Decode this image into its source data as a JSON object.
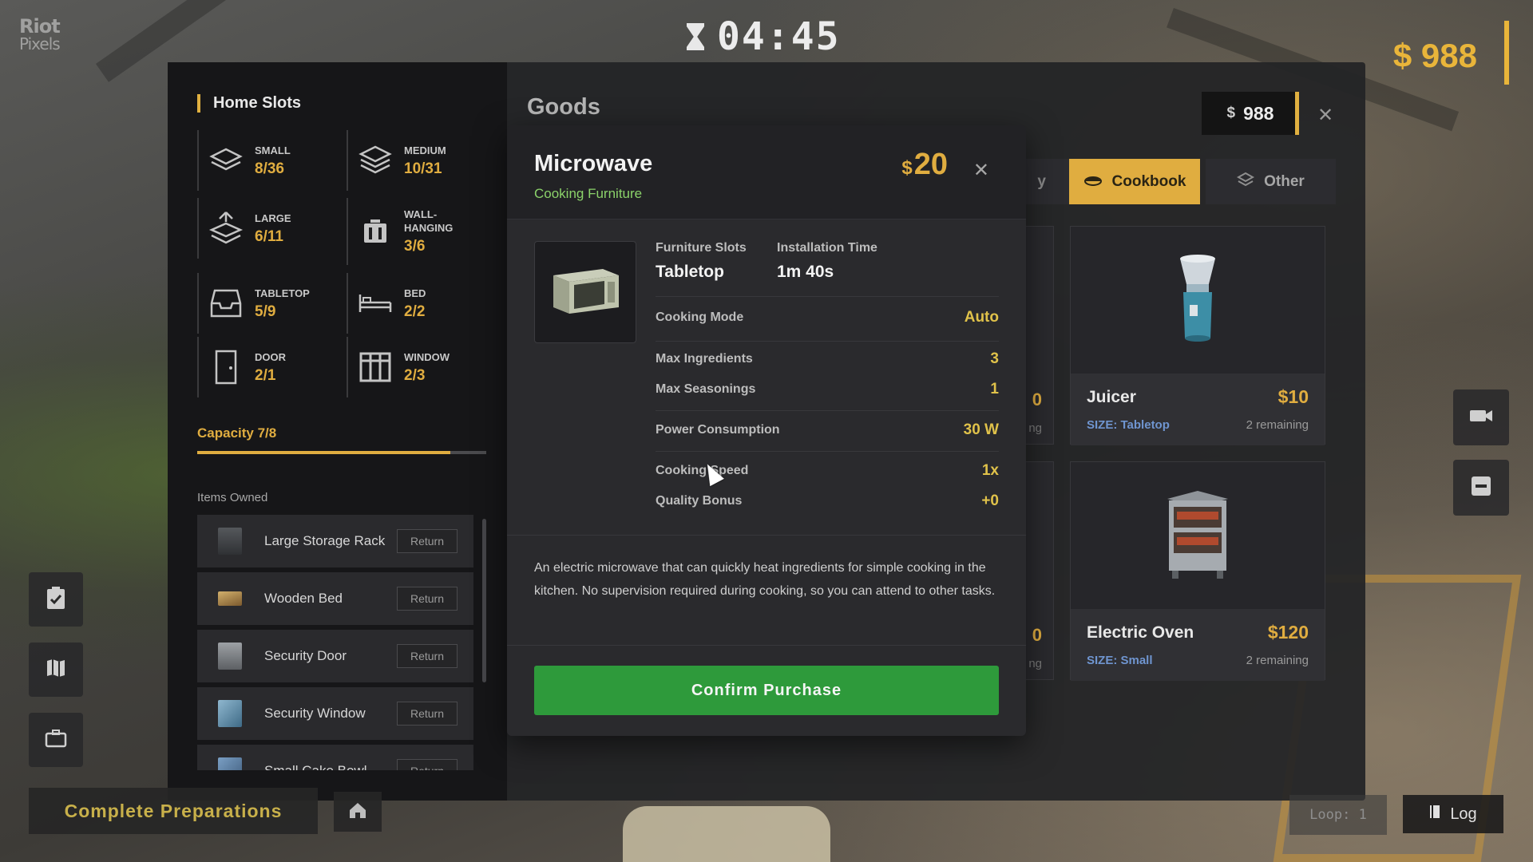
{
  "watermark": {
    "line1": "Riot",
    "line2": "Pixels"
  },
  "hud": {
    "timer": "04:45",
    "money": "$ 988",
    "complete_label": "Complete Preparations",
    "loop_label": "Loop: 1",
    "log_label": "Log"
  },
  "home_slots": {
    "title": "Home Slots",
    "slots": [
      {
        "label": "SMALL",
        "value": "8/36",
        "icon": "stack-icon"
      },
      {
        "label": "MEDIUM",
        "value": "10/31",
        "icon": "stack-icon"
      },
      {
        "label": "LARGE",
        "value": "6/11",
        "icon": "stack-up-icon"
      },
      {
        "label": "WALL-HANGING",
        "value": "3/6",
        "icon": "cabinet-icon"
      },
      {
        "label": "TABLETOP",
        "value": "5/9",
        "icon": "tray-icon"
      },
      {
        "label": "BED",
        "value": "2/2",
        "icon": "bed-icon"
      },
      {
        "label": "DOOR",
        "value": "2/1",
        "icon": "door-icon"
      },
      {
        "label": "WINDOW",
        "value": "2/3",
        "icon": "window-icon"
      }
    ],
    "capacity_label": "Capacity 7/8",
    "capacity_fraction": 0.875,
    "items_owned_label": "Items Owned",
    "items": [
      {
        "name": "Large Storage Rack",
        "action": "Return"
      },
      {
        "name": "Wooden Bed",
        "action": "Return"
      },
      {
        "name": "Security Door",
        "action": "Return"
      },
      {
        "name": "Security Window",
        "action": "Return"
      },
      {
        "name": "Small Cake Bowl",
        "action": "Return"
      }
    ]
  },
  "goods": {
    "title": "Goods",
    "money_symbol": "$",
    "money": "988",
    "tabs": [
      {
        "label": "y",
        "active": false
      },
      {
        "label": "Cookbook",
        "active": true
      },
      {
        "label": "Other",
        "active": false
      }
    ],
    "partial_cards": [
      {
        "price": "0",
        "remaining": "ng"
      },
      {
        "price": "0",
        "remaining": "ng"
      }
    ],
    "cards": [
      {
        "name": "Juicer",
        "price": "$10",
        "size": "SIZE: Tabletop",
        "remaining": "2 remaining"
      },
      {
        "name": "Electric Oven",
        "price": "$120",
        "size": "SIZE: Small",
        "remaining": "2 remaining"
      }
    ]
  },
  "modal": {
    "title": "Microwave",
    "subtitle": "Cooking Furniture",
    "currency": "$",
    "price": "20",
    "furniture_slots_label": "Furniture Slots",
    "furniture_slots_value": "Tabletop",
    "install_time_label": "Installation Time",
    "install_time_value": "1m 40s",
    "stats": [
      {
        "label": "Cooking Mode",
        "value": "Auto"
      },
      {
        "label": "Max Ingredients",
        "value": "3"
      },
      {
        "label": "Max Seasonings",
        "value": "1"
      },
      {
        "label": "Power Consumption",
        "value": "30 W"
      },
      {
        "label": "Cooking Speed",
        "value": "1x"
      },
      {
        "label": "Quality Bonus",
        "value": "+0"
      }
    ],
    "description": "An electric microwave that can quickly heat ingredients for simple cooking in the kitchen. No supervision required during cooking, so you can attend to other tasks.",
    "confirm_label": "Confirm Purchase"
  },
  "colors": {
    "accent": "#e0ad40",
    "confirm": "#2e9a3b",
    "subtitle": "#8bd26a",
    "size_text": "#6f95d0"
  }
}
